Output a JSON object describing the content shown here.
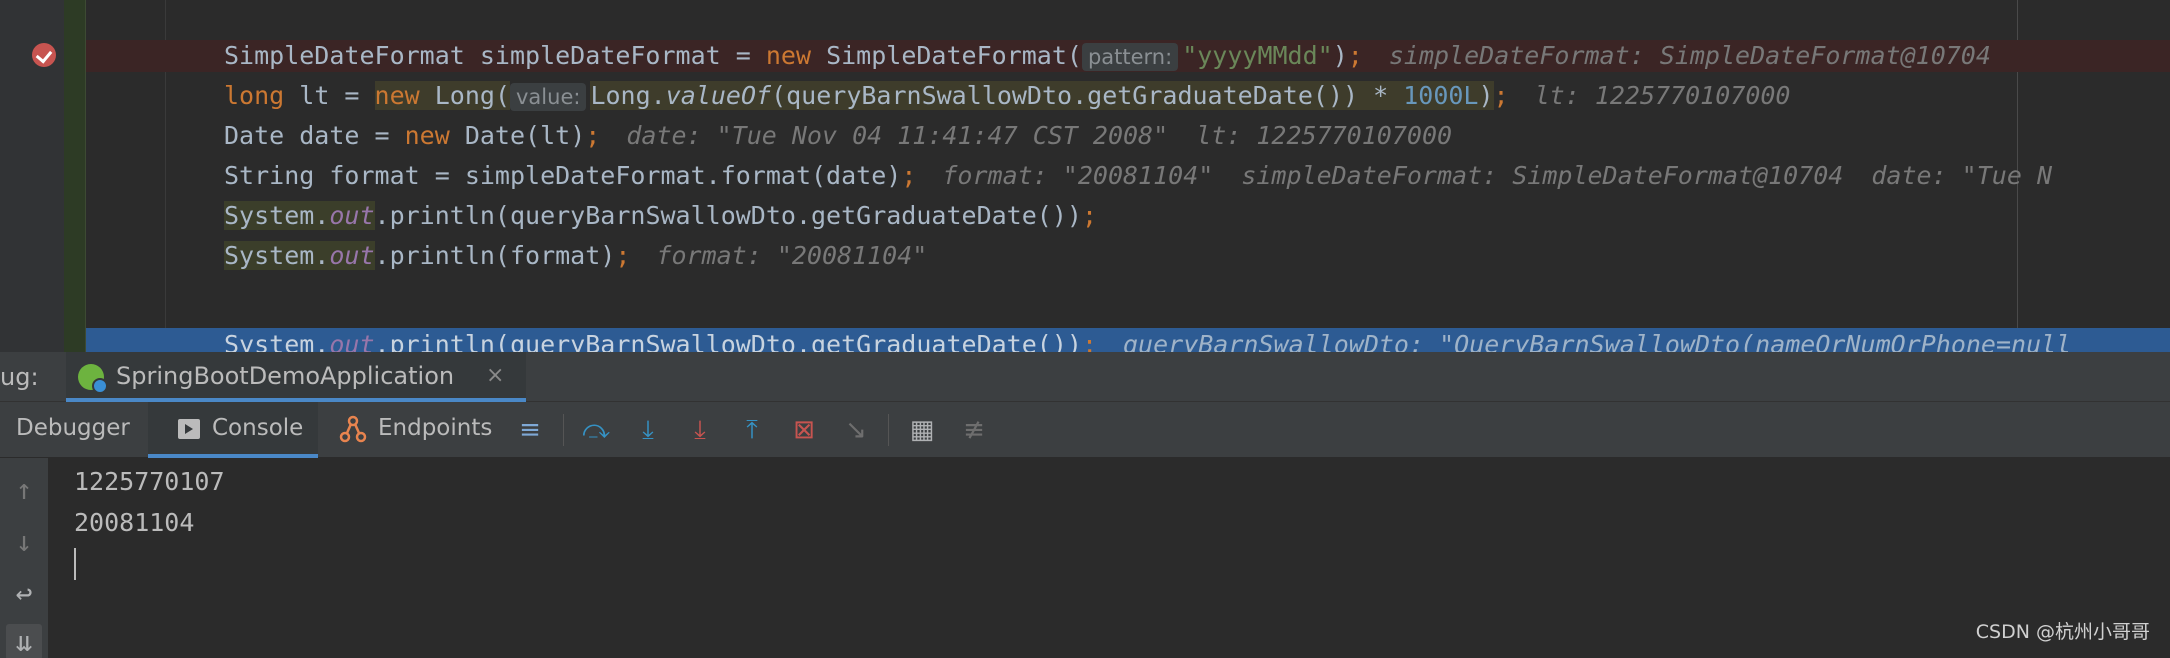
{
  "editor": {
    "line1": {
      "a": "SimpleDateFormat simpleDateFormat = ",
      "kw": "new",
      "b": " SimpleDateFormat(",
      "hint": "pattern:",
      "str": "\"yyyyMMdd\"",
      "c": ")",
      "semi": ";",
      "inline": "simpleDateFormat: SimpleDateFormat@10704"
    },
    "line2": {
      "kw1": "long",
      "a": " lt = ",
      "kw2": "new",
      "b": " Long(",
      "hint": "value:",
      "c": "Long.",
      "method": "valueOf",
      "d": "(queryBarnSwallowDto.getGraduateDate()) * ",
      "num": "1000L",
      "e": ")",
      "semi": ";",
      "inline": "lt: 1225770107000"
    },
    "line3": {
      "a": "Date date = ",
      "kw": "new",
      "b": " Date(lt)",
      "semi": ";",
      "inline1": "date: \"Tue Nov 04 11:41:47 CST 2008\"",
      "inline2": "lt: 1225770107000"
    },
    "line4": {
      "a": "String format = simpleDateFormat.format(date)",
      "semi": ";",
      "inline1": "format: \"20081104\"",
      "inline2": "simpleDateFormat: SimpleDateFormat@10704",
      "inline3": "date: \"Tue N"
    },
    "line5": {
      "cls": "System.",
      "field": "out",
      "a": ".println(queryBarnSwallowDto.getGraduateDate())",
      "semi": ";"
    },
    "line6": {
      "cls": "System.",
      "field": "out",
      "a": ".println(format)",
      "semi": ";",
      "inline": "format: \"20081104\""
    },
    "line7": {
      "cls": "System.",
      "field": "out",
      "a": ".println(queryBarnSwallowDto.getGraduateDate())",
      "semi": ";",
      "inline": "queryBarnSwallowDto: \"QueryBarnSwallowDto(nameOrNumOrPhone=null"
    }
  },
  "debug_panel": {
    "tool_label": "ug:",
    "run_config_tab": "SpringBootDemoApplication",
    "close_symbol": "×"
  },
  "toolbar": {
    "tabs": {
      "debugger": "Debugger",
      "console": "Console",
      "endpoints": "Endpoints"
    },
    "icons": {
      "show-execution-point": "≡",
      "step-over": "⤼",
      "step-into": "⤓",
      "force-step-into": "⤓",
      "step-out": "⤒",
      "drop-frame": "⊠",
      "run-to-cursor": "↘",
      "evaluate-expression": "▦",
      "trace-current-stream": "≢"
    },
    "colors": {
      "accent": "#4a88c7",
      "step_into_red": "#c75450"
    }
  },
  "console": {
    "lines": [
      "1225770107",
      "20081104"
    ]
  },
  "console_side": {
    "icons": [
      "↑",
      "↓",
      "↩",
      "⇊"
    ]
  },
  "watermark": "CSDN @杭州小哥哥"
}
